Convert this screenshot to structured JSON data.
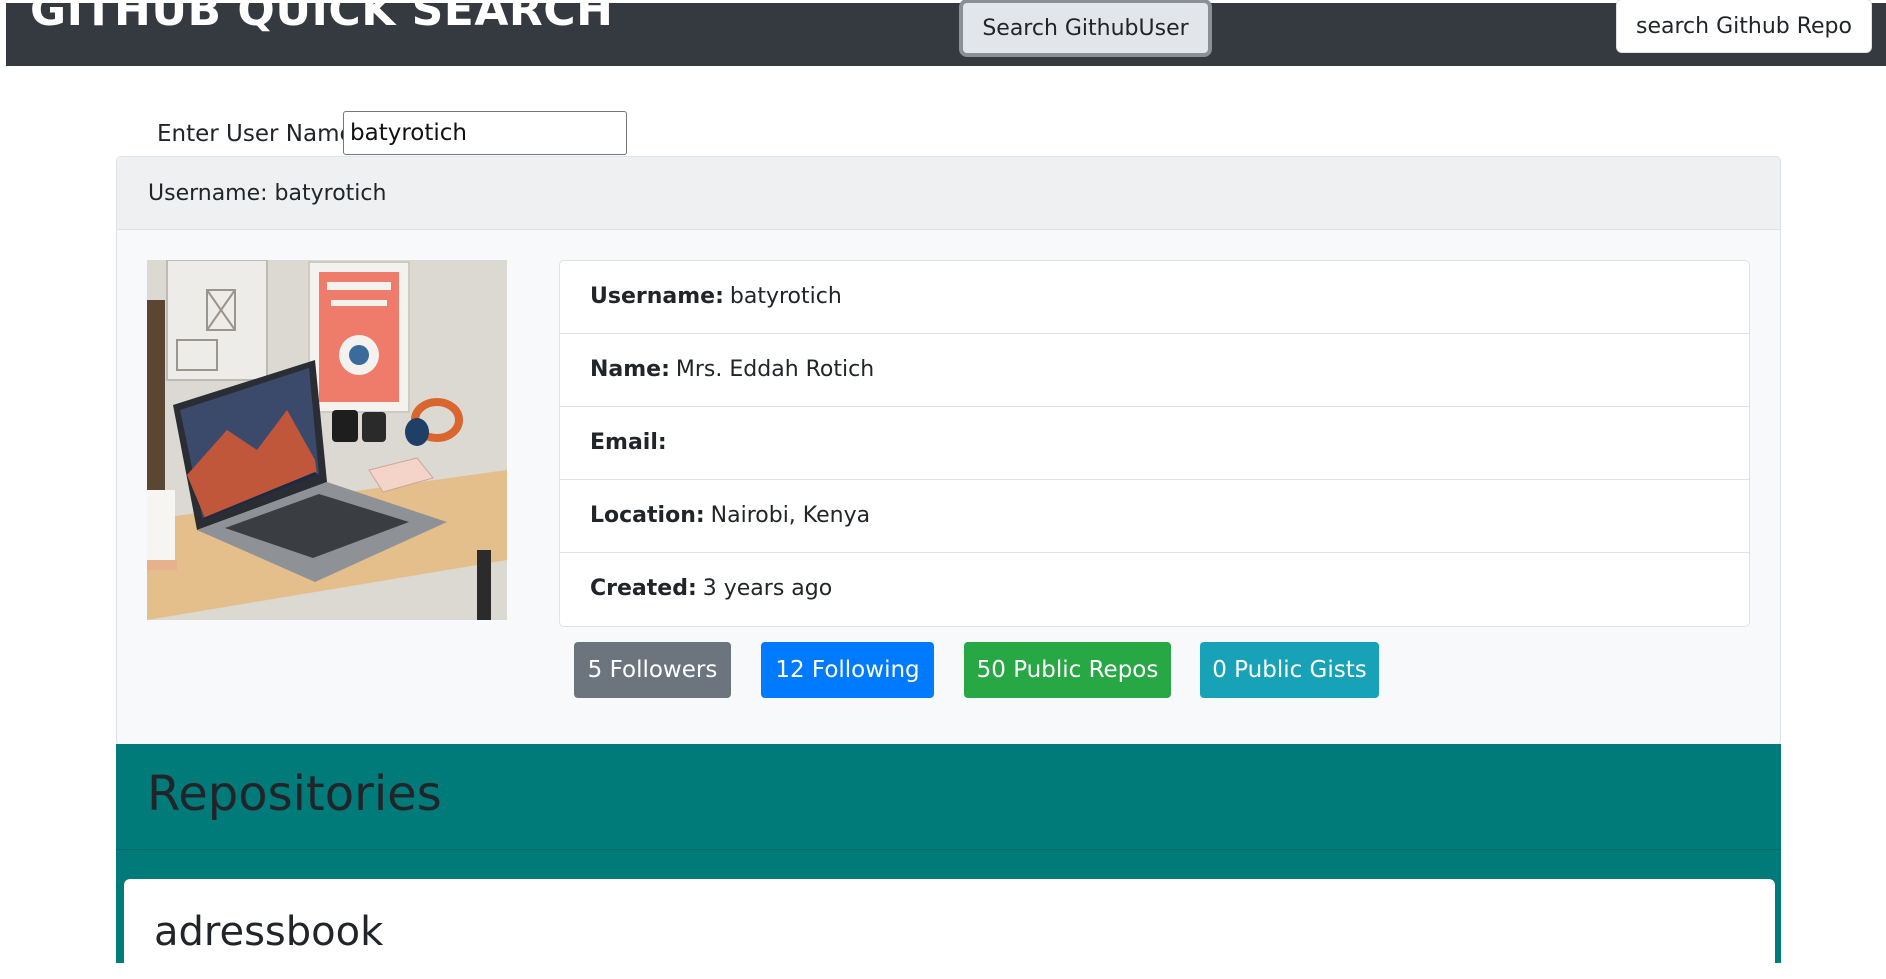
{
  "navbar": {
    "brand": "GITHUB QUICK SEARCH",
    "search_user_label": "Search GithubUser",
    "search_repo_label": "search Github Repo"
  },
  "search": {
    "label": "Enter User Name",
    "value": "batyrotich"
  },
  "profile": {
    "header": "Username: batyrotich",
    "fields": [
      {
        "label": "Username:",
        "value": "batyrotich"
      },
      {
        "label": "Name:",
        "value": "Mrs. Eddah Rotich"
      },
      {
        "label": "Email:",
        "value": ""
      },
      {
        "label": "Location:",
        "value": "Nairobi, Kenya"
      },
      {
        "label": "Created:",
        "value": "3 years ago"
      }
    ],
    "badges": {
      "followers": "5 Followers",
      "following": "12 Following",
      "repos": "50 Public Repos",
      "gists": "0 Public Gists"
    }
  },
  "repositories": {
    "title": "Repositories",
    "items": [
      {
        "name": "adressbook"
      }
    ]
  },
  "colors": {
    "navbar": "#343a40",
    "followers": "#6c757d",
    "following": "#007bff",
    "repos": "#28a745",
    "gists": "#17a2b8",
    "repo_section": "#007b7a"
  }
}
